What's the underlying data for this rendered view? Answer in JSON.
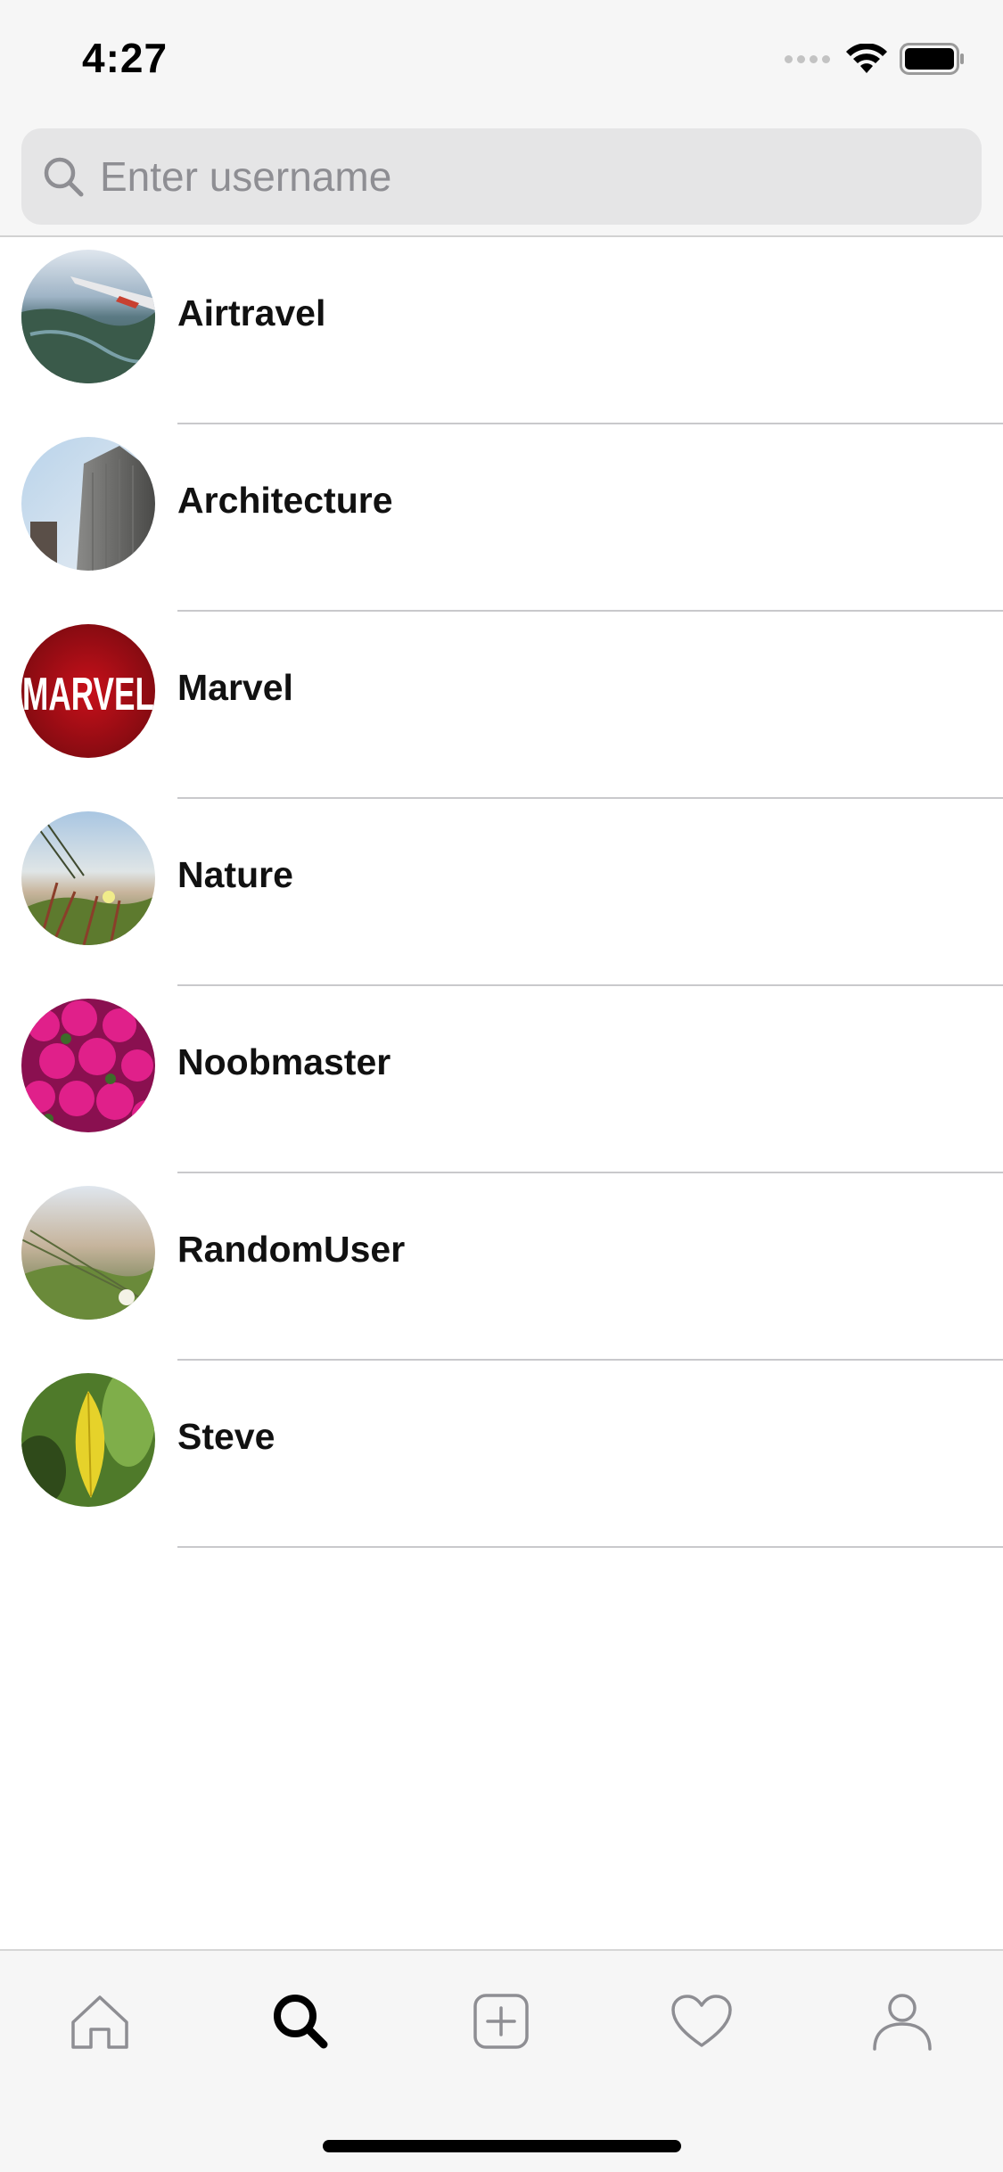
{
  "status_bar": {
    "time": "4:27"
  },
  "search": {
    "placeholder": "Enter username",
    "value": ""
  },
  "users": [
    {
      "name": "Airtravel"
    },
    {
      "name": "Architecture"
    },
    {
      "name": "Marvel",
      "avatar_text": "MARVEL"
    },
    {
      "name": "Nature"
    },
    {
      "name": "Noobmaster"
    },
    {
      "name": "RandomUser"
    },
    {
      "name": "Steve"
    }
  ],
  "tab_bar": {
    "tabs": [
      {
        "name": "home",
        "icon": "home-icon",
        "selected": false
      },
      {
        "name": "search",
        "icon": "search-icon",
        "selected": true
      },
      {
        "name": "add-post",
        "icon": "plus-square-icon",
        "selected": false
      },
      {
        "name": "activity",
        "icon": "heart-icon",
        "selected": false
      },
      {
        "name": "profile",
        "icon": "person-icon",
        "selected": false
      }
    ]
  },
  "colors": {
    "bar_background": "#f6f6f6",
    "search_field": "#e5e5e6",
    "placeholder": "#8e8e93",
    "tab_inactive": "#8e8e93",
    "tab_active": "#000000",
    "divider": "#c9c9cc"
  }
}
